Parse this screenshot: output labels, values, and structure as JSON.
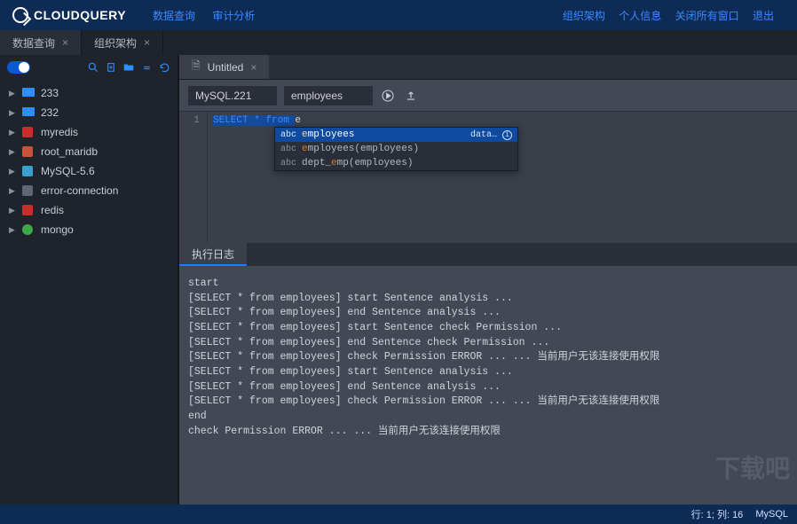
{
  "header": {
    "logo_text": "CLOUDQUERY",
    "nav_left": [
      "数据查询",
      "审计分析"
    ],
    "nav_right": [
      "组织架构",
      "个人信息",
      "关闭所有窗口",
      "退出"
    ]
  },
  "main_tabs": [
    {
      "label": "数据查询",
      "active": true
    },
    {
      "label": "组织架构",
      "active": false
    }
  ],
  "sidebar": {
    "items": [
      {
        "label": "233",
        "icon": "folder"
      },
      {
        "label": "232",
        "icon": "folder"
      },
      {
        "label": "myredis",
        "icon": "redis"
      },
      {
        "label": "root_maridb",
        "icon": "db-red"
      },
      {
        "label": "MySQL-5.6",
        "icon": "db"
      },
      {
        "label": "error-connection",
        "icon": "db-gray"
      },
      {
        "label": "redis",
        "icon": "redis"
      },
      {
        "label": "mongo",
        "icon": "mongo"
      }
    ]
  },
  "editor": {
    "tab_label": "Untitled",
    "datasource": "MySQL.221",
    "database": "employees",
    "line_no": "1",
    "code_keywords": "SELECT * from ",
    "code_tail": "e",
    "autocomplete": {
      "items": [
        {
          "type": "abc",
          "prefix": "e",
          "rest": "mployees",
          "meta": "data…"
        },
        {
          "type": "abc",
          "prefix": "e",
          "rest": "mployees(employees)",
          "meta": ""
        },
        {
          "type": "abc",
          "prefix": "dept_",
          "match": "e",
          "rest2": "mp(employees)",
          "meta": ""
        }
      ]
    }
  },
  "log": {
    "tab_label": "执行日志",
    "lines": [
      "start",
      "[SELECT * from employees] start Sentence analysis ...",
      "[SELECT * from employees] end Sentence analysis ...",
      "[SELECT * from employees] start Sentence check Permission ...",
      "[SELECT * from employees] end Sentence check Permission ...",
      "[SELECT * from employees] check Permission ERROR ... ... 当前用户无该连接使用权限",
      "[SELECT * from employees] start Sentence analysis ...",
      "[SELECT * from employees] end Sentence analysis ...",
      "[SELECT * from employees] check Permission ERROR ... ... 当前用户无该连接使用权限",
      "end",
      "check Permission ERROR ... ... 当前用户无该连接使用权限"
    ]
  },
  "statusbar": {
    "position": "行: 1; 列: 16",
    "engine": "MySQL"
  },
  "watermark": "下载吧"
}
